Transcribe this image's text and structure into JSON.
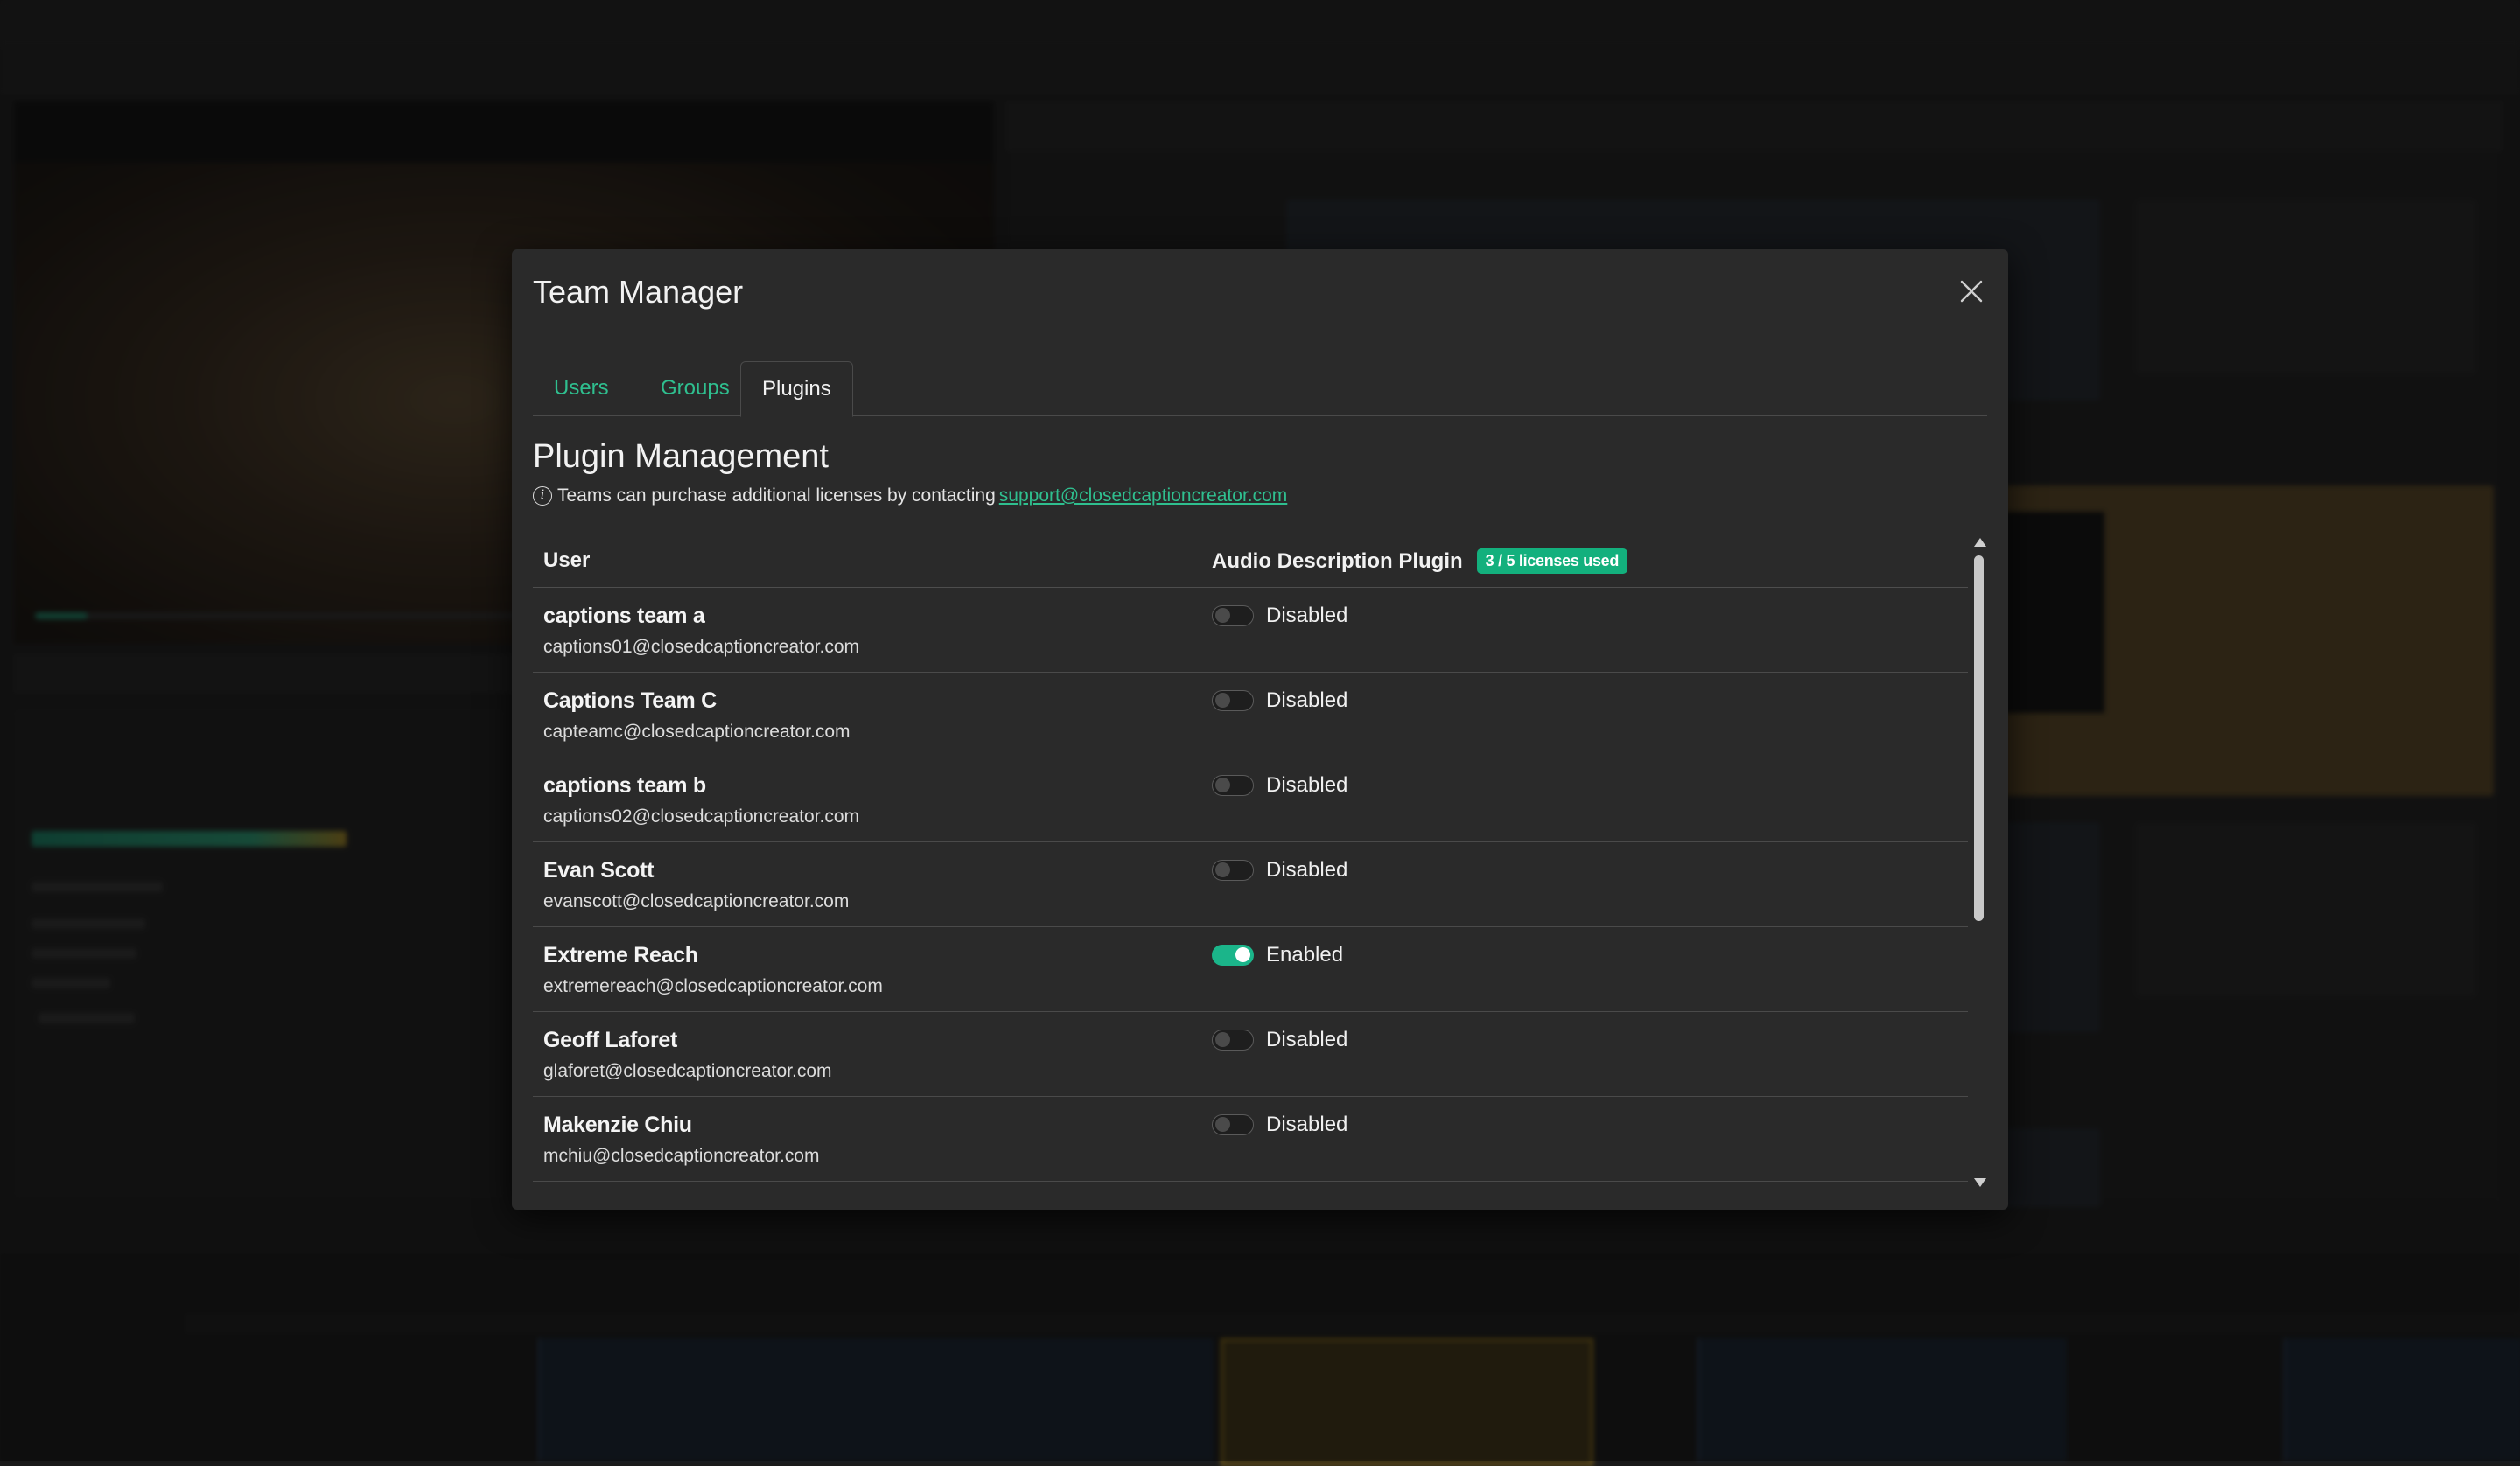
{
  "modal": {
    "title": "Team Manager",
    "close_icon": "close-icon"
  },
  "tabs": [
    {
      "label": "Users",
      "active": false
    },
    {
      "label": "Groups",
      "active": false
    },
    {
      "label": "Plugins",
      "active": true
    }
  ],
  "plugin_management": {
    "title": "Plugin Management",
    "info_icon": "info-circle-icon",
    "info_text": "Teams can purchase additional licenses by contacting",
    "support_email": "support@closedcaptioncreator.com"
  },
  "table": {
    "col_user": "User",
    "col_plugin": "Audio Description Plugin",
    "license_badge": "3 / 5 licenses used",
    "rows": [
      {
        "name": "captions team a",
        "email": "captions01@closedcaptioncreator.com",
        "status": "Disabled",
        "enabled": false
      },
      {
        "name": "Captions Team C",
        "email": "capteamc@closedcaptioncreator.com",
        "status": "Disabled",
        "enabled": false
      },
      {
        "name": "captions team b",
        "email": "captions02@closedcaptioncreator.com",
        "status": "Disabled",
        "enabled": false
      },
      {
        "name": "Evan Scott",
        "email": "evanscott@closedcaptioncreator.com",
        "status": "Disabled",
        "enabled": false
      },
      {
        "name": "Extreme Reach",
        "email": "extremereach@closedcaptioncreator.com",
        "status": "Enabled",
        "enabled": true
      },
      {
        "name": "Geoff Laforet",
        "email": "glaforet@closedcaptioncreator.com",
        "status": "Disabled",
        "enabled": false
      },
      {
        "name": "Makenzie Chiu",
        "email": "mchiu@closedcaptioncreator.com",
        "status": "Disabled",
        "enabled": false
      }
    ]
  },
  "colors": {
    "accent": "#2fbf8f",
    "badge": "#13b07d",
    "modal_bg": "#2a2a2a"
  }
}
